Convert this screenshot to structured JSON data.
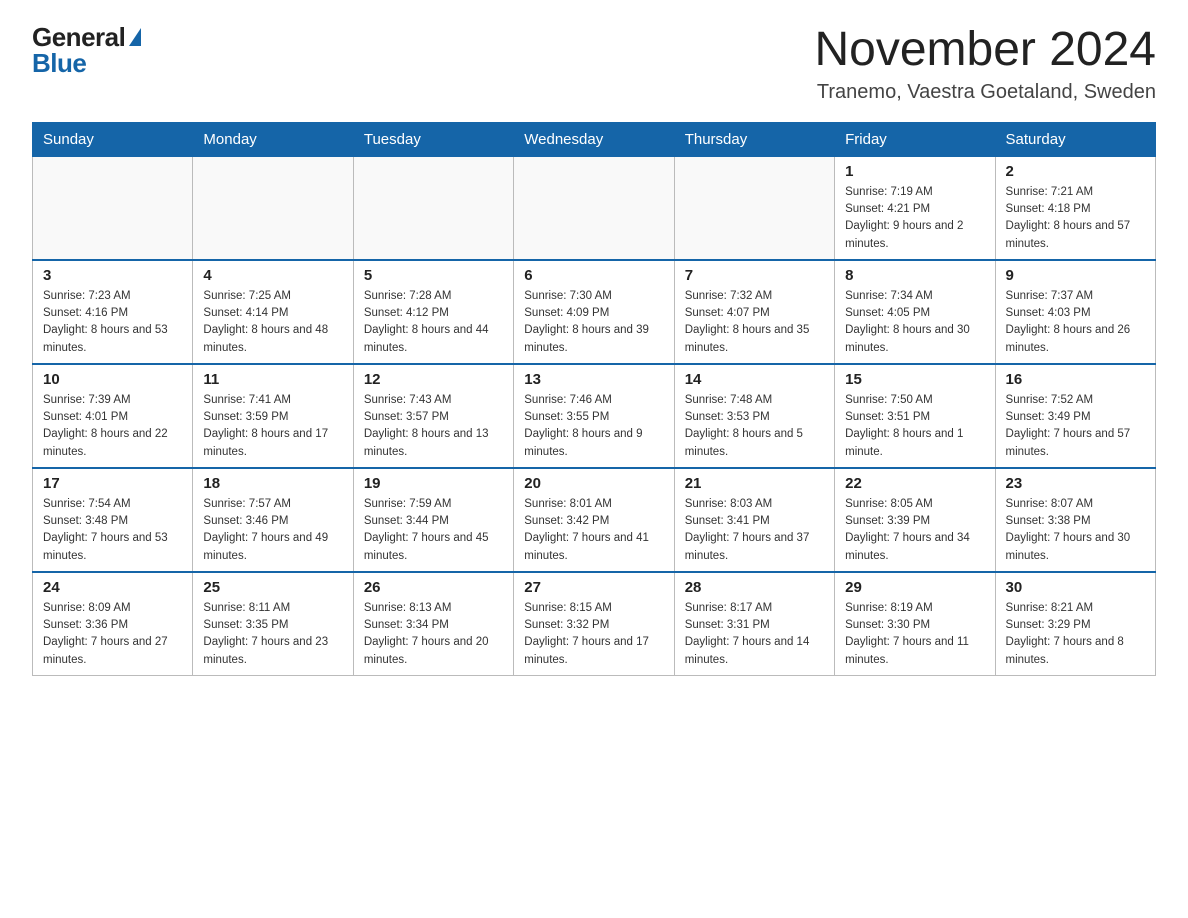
{
  "header": {
    "logo_general": "General",
    "logo_blue": "Blue",
    "month_title": "November 2024",
    "location": "Tranemo, Vaestra Goetaland, Sweden"
  },
  "days_of_week": [
    "Sunday",
    "Monday",
    "Tuesday",
    "Wednesday",
    "Thursday",
    "Friday",
    "Saturday"
  ],
  "weeks": [
    [
      {
        "day": "",
        "info": ""
      },
      {
        "day": "",
        "info": ""
      },
      {
        "day": "",
        "info": ""
      },
      {
        "day": "",
        "info": ""
      },
      {
        "day": "",
        "info": ""
      },
      {
        "day": "1",
        "info": "Sunrise: 7:19 AM\nSunset: 4:21 PM\nDaylight: 9 hours and 2 minutes."
      },
      {
        "day": "2",
        "info": "Sunrise: 7:21 AM\nSunset: 4:18 PM\nDaylight: 8 hours and 57 minutes."
      }
    ],
    [
      {
        "day": "3",
        "info": "Sunrise: 7:23 AM\nSunset: 4:16 PM\nDaylight: 8 hours and 53 minutes."
      },
      {
        "day": "4",
        "info": "Sunrise: 7:25 AM\nSunset: 4:14 PM\nDaylight: 8 hours and 48 minutes."
      },
      {
        "day": "5",
        "info": "Sunrise: 7:28 AM\nSunset: 4:12 PM\nDaylight: 8 hours and 44 minutes."
      },
      {
        "day": "6",
        "info": "Sunrise: 7:30 AM\nSunset: 4:09 PM\nDaylight: 8 hours and 39 minutes."
      },
      {
        "day": "7",
        "info": "Sunrise: 7:32 AM\nSunset: 4:07 PM\nDaylight: 8 hours and 35 minutes."
      },
      {
        "day": "8",
        "info": "Sunrise: 7:34 AM\nSunset: 4:05 PM\nDaylight: 8 hours and 30 minutes."
      },
      {
        "day": "9",
        "info": "Sunrise: 7:37 AM\nSunset: 4:03 PM\nDaylight: 8 hours and 26 minutes."
      }
    ],
    [
      {
        "day": "10",
        "info": "Sunrise: 7:39 AM\nSunset: 4:01 PM\nDaylight: 8 hours and 22 minutes."
      },
      {
        "day": "11",
        "info": "Sunrise: 7:41 AM\nSunset: 3:59 PM\nDaylight: 8 hours and 17 minutes."
      },
      {
        "day": "12",
        "info": "Sunrise: 7:43 AM\nSunset: 3:57 PM\nDaylight: 8 hours and 13 minutes."
      },
      {
        "day": "13",
        "info": "Sunrise: 7:46 AM\nSunset: 3:55 PM\nDaylight: 8 hours and 9 minutes."
      },
      {
        "day": "14",
        "info": "Sunrise: 7:48 AM\nSunset: 3:53 PM\nDaylight: 8 hours and 5 minutes."
      },
      {
        "day": "15",
        "info": "Sunrise: 7:50 AM\nSunset: 3:51 PM\nDaylight: 8 hours and 1 minute."
      },
      {
        "day": "16",
        "info": "Sunrise: 7:52 AM\nSunset: 3:49 PM\nDaylight: 7 hours and 57 minutes."
      }
    ],
    [
      {
        "day": "17",
        "info": "Sunrise: 7:54 AM\nSunset: 3:48 PM\nDaylight: 7 hours and 53 minutes."
      },
      {
        "day": "18",
        "info": "Sunrise: 7:57 AM\nSunset: 3:46 PM\nDaylight: 7 hours and 49 minutes."
      },
      {
        "day": "19",
        "info": "Sunrise: 7:59 AM\nSunset: 3:44 PM\nDaylight: 7 hours and 45 minutes."
      },
      {
        "day": "20",
        "info": "Sunrise: 8:01 AM\nSunset: 3:42 PM\nDaylight: 7 hours and 41 minutes."
      },
      {
        "day": "21",
        "info": "Sunrise: 8:03 AM\nSunset: 3:41 PM\nDaylight: 7 hours and 37 minutes."
      },
      {
        "day": "22",
        "info": "Sunrise: 8:05 AM\nSunset: 3:39 PM\nDaylight: 7 hours and 34 minutes."
      },
      {
        "day": "23",
        "info": "Sunrise: 8:07 AM\nSunset: 3:38 PM\nDaylight: 7 hours and 30 minutes."
      }
    ],
    [
      {
        "day": "24",
        "info": "Sunrise: 8:09 AM\nSunset: 3:36 PM\nDaylight: 7 hours and 27 minutes."
      },
      {
        "day": "25",
        "info": "Sunrise: 8:11 AM\nSunset: 3:35 PM\nDaylight: 7 hours and 23 minutes."
      },
      {
        "day": "26",
        "info": "Sunrise: 8:13 AM\nSunset: 3:34 PM\nDaylight: 7 hours and 20 minutes."
      },
      {
        "day": "27",
        "info": "Sunrise: 8:15 AM\nSunset: 3:32 PM\nDaylight: 7 hours and 17 minutes."
      },
      {
        "day": "28",
        "info": "Sunrise: 8:17 AM\nSunset: 3:31 PM\nDaylight: 7 hours and 14 minutes."
      },
      {
        "day": "29",
        "info": "Sunrise: 8:19 AM\nSunset: 3:30 PM\nDaylight: 7 hours and 11 minutes."
      },
      {
        "day": "30",
        "info": "Sunrise: 8:21 AM\nSunset: 3:29 PM\nDaylight: 7 hours and 8 minutes."
      }
    ]
  ]
}
